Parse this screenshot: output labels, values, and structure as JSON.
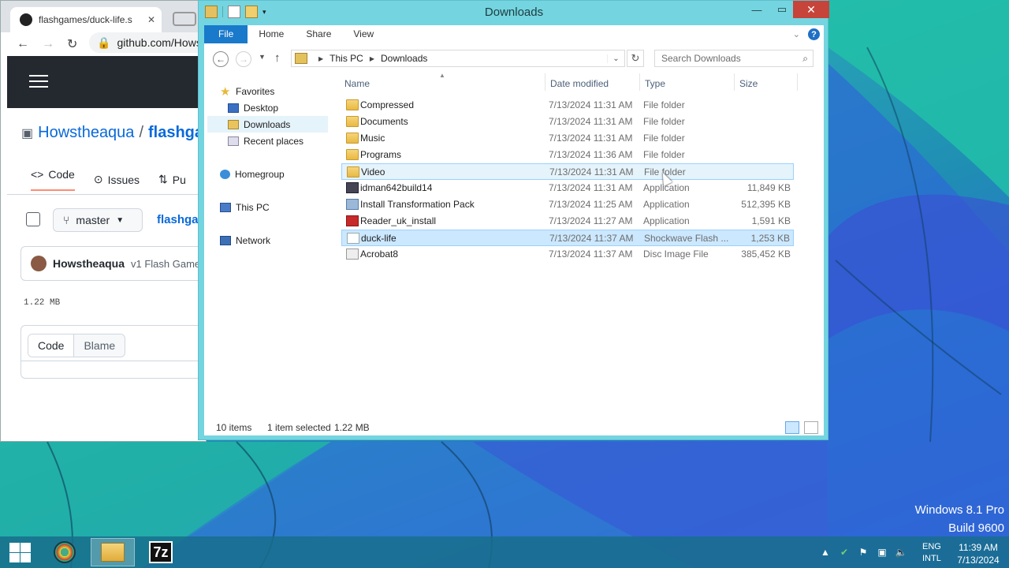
{
  "browser": {
    "tab_title": "flashgames/duck-life.s",
    "url": "github.com/Hows",
    "repo_owner": "Howstheaqua",
    "repo_sep": "/",
    "repo_name": "flashga",
    "tabs": [
      "Code",
      "Issues",
      "Pu"
    ],
    "branch": "master",
    "path_crumb": "flashga",
    "commit_author": "Howstheaqua",
    "commit_message": "v1 Flash Game",
    "file_size": "1.22 MB",
    "view_code": "Code",
    "view_blame": "Blame"
  },
  "explorer": {
    "title": "Downloads",
    "ribbon_tabs": [
      "File",
      "Home",
      "Share",
      "View"
    ],
    "address": [
      "This PC",
      "Downloads"
    ],
    "search_placeholder": "Search Downloads",
    "nav": {
      "favorites": "Favorites",
      "desktop": "Desktop",
      "downloads": "Downloads",
      "recent": "Recent places",
      "homegroup": "Homegroup",
      "thispc": "This PC",
      "network": "Network"
    },
    "columns": {
      "name": "Name",
      "date": "Date modified",
      "type": "Type",
      "size": "Size"
    },
    "files": [
      {
        "name": "Compressed",
        "date": "7/13/2024 11:31 AM",
        "type": "File folder",
        "size": "",
        "icon": "folder-icon"
      },
      {
        "name": "Documents",
        "date": "7/13/2024 11:31 AM",
        "type": "File folder",
        "size": "",
        "icon": "folder-icon"
      },
      {
        "name": "Music",
        "date": "7/13/2024 11:31 AM",
        "type": "File folder",
        "size": "",
        "icon": "folder-icon"
      },
      {
        "name": "Programs",
        "date": "7/13/2024 11:36 AM",
        "type": "File folder",
        "size": "",
        "icon": "folder-icon"
      },
      {
        "name": "Video",
        "date": "7/13/2024 11:31 AM",
        "type": "File folder",
        "size": "",
        "icon": "folder-icon"
      },
      {
        "name": "idman642build14",
        "date": "7/13/2024 11:31 AM",
        "type": "Application",
        "size": "11,849 KB",
        "icon": "app-icon"
      },
      {
        "name": "Install Transformation Pack",
        "date": "7/13/2024 11:25 AM",
        "type": "Application",
        "size": "512,395 KB",
        "icon": "installer-icon"
      },
      {
        "name": "Reader_uk_install",
        "date": "7/13/2024 11:27 AM",
        "type": "Application",
        "size": "1,591 KB",
        "icon": "pdf-icon"
      },
      {
        "name": "duck-life",
        "date": "7/13/2024 11:37 AM",
        "type": "Shockwave Flash ...",
        "size": "1,253 KB",
        "icon": "file-icon"
      },
      {
        "name": "Acrobat8",
        "date": "7/13/2024 11:37 AM",
        "type": "Disc Image File",
        "size": "385,452 KB",
        "icon": "disc-image-icon"
      }
    ],
    "status": {
      "count": "10 items",
      "selected": "1 item selected",
      "selsize": "1.22 MB"
    }
  },
  "desktop": {
    "os_line1": "Windows 8.1 Pro",
    "os_line2": "Build 9600"
  },
  "taskbar": {
    "lang1": "ENG",
    "lang2": "INTL",
    "time": "11:39 AM",
    "date": "7/13/2024",
    "z7_label": "7z"
  }
}
